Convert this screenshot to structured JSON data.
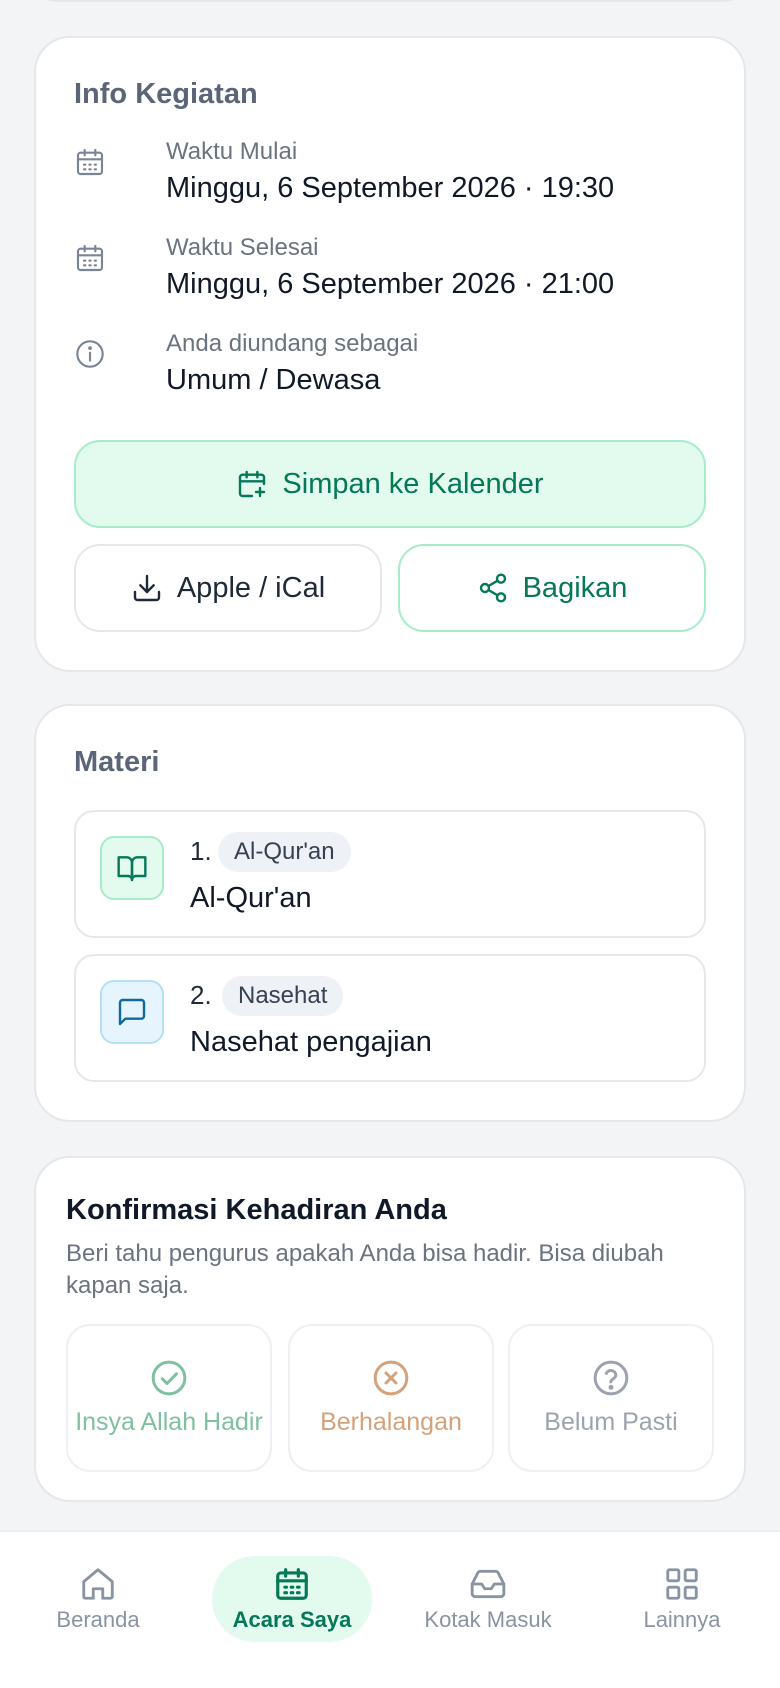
{
  "info": {
    "title": "Info Kegiatan",
    "start_label": "Waktu Mulai",
    "start_value": "Minggu, 6 September 2026 · 19:30",
    "end_label": "Waktu Selesai",
    "end_value": "Minggu, 6 September 2026 · 21:00",
    "invite_label": "Anda diundang sebagai",
    "invite_value": "Umum / Dewasa",
    "save_calendar_label": "Simpan ke Kalender",
    "ical_label": "Apple / iCal",
    "share_label": "Bagikan"
  },
  "materi": {
    "title": "Materi",
    "items": [
      {
        "number": "1.",
        "tag": "Al-Qur'an",
        "title": "Al-Qur'an",
        "icon": "book-open-icon"
      },
      {
        "number": "2.",
        "tag": "Nasehat",
        "title": "Nasehat pengajian",
        "icon": "message-square-icon"
      }
    ]
  },
  "rsvp": {
    "title": "Konfirmasi Kehadiran Anda",
    "description": "Beri tahu pengurus apakah Anda bisa hadir. Bisa diubah kapan saja.",
    "options": [
      {
        "label": "Insya Allah Hadir",
        "icon": "check-circle-icon",
        "color": "#7fc0a0"
      },
      {
        "label": "Berhalangan",
        "icon": "x-circle-icon",
        "color": "#d4a27a"
      },
      {
        "label": "Belum Pasti",
        "icon": "help-circle-icon",
        "color": "#9ca3af"
      }
    ]
  },
  "nav": {
    "items": [
      {
        "label": "Beranda",
        "icon": "home-icon"
      },
      {
        "label": "Acara Saya",
        "icon": "calendar-icon",
        "active": true
      },
      {
        "label": "Kotak Masuk",
        "icon": "inbox-icon"
      },
      {
        "label": "Lainnya",
        "icon": "grid-icon"
      }
    ]
  },
  "colors": {
    "accent": "#047857",
    "accent_bg": "#e3faef",
    "accent_border": "#a7ecc8",
    "background": "#f3f4f6"
  }
}
